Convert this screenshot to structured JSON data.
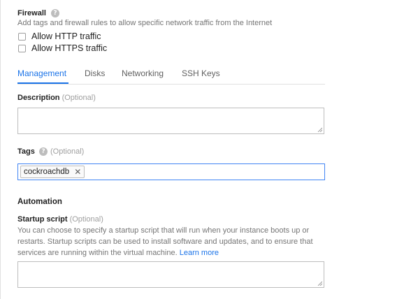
{
  "firewall": {
    "heading": "Firewall",
    "help_glyph": "?",
    "description": "Add tags and firewall rules to allow specific network traffic from the Internet",
    "options": [
      {
        "label": "Allow HTTP traffic",
        "checked": false
      },
      {
        "label": "Allow HTTPS traffic",
        "checked": false
      }
    ]
  },
  "tabs": [
    {
      "label": "Management",
      "active": true
    },
    {
      "label": "Disks",
      "active": false
    },
    {
      "label": "Networking",
      "active": false
    },
    {
      "label": "SSH Keys",
      "active": false
    }
  ],
  "description_field": {
    "label": "Description",
    "optional": "(Optional)",
    "value": ""
  },
  "tags_field": {
    "label": "Tags",
    "help_glyph": "?",
    "optional": "(Optional)",
    "tags": [
      "cockroachdb"
    ],
    "remove_glyph": "✕"
  },
  "automation": {
    "heading": "Automation",
    "startup_script": {
      "label": "Startup script",
      "optional": "(Optional)",
      "help_text": "You can choose to specify a startup script that will run when your instance boots up or restarts. Startup scripts can be used to install software and updates, and to ensure that services are running within the virtual machine.",
      "link_text": "Learn more",
      "value": ""
    }
  },
  "colors": {
    "accent": "#1a73e8",
    "focus_border": "#4285f4",
    "muted_text": "#757575"
  }
}
